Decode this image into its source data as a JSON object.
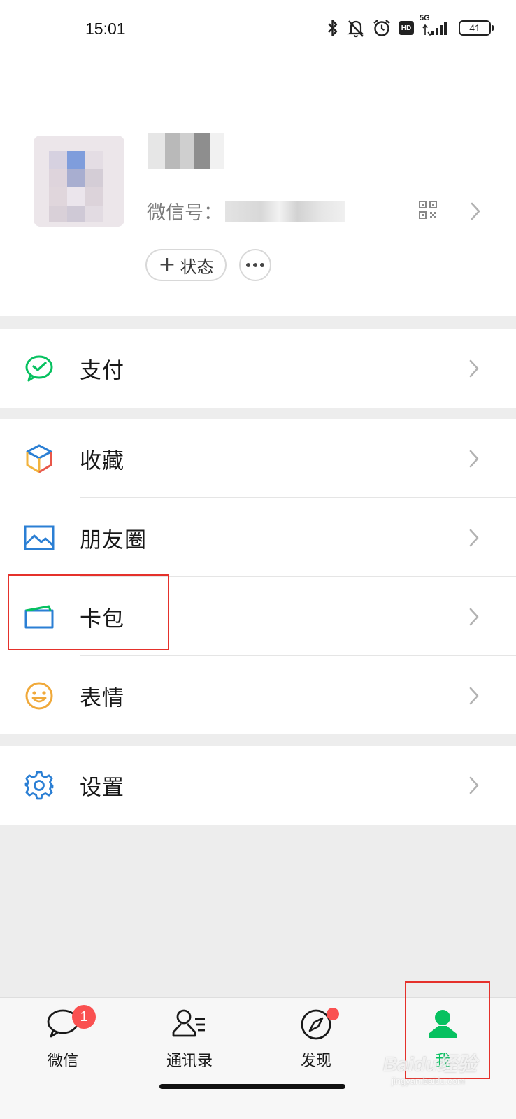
{
  "status_bar": {
    "time": "15:01",
    "network": "5G",
    "hd": "HD",
    "battery": "41"
  },
  "profile": {
    "wxid_label": "微信号：",
    "status_button": "状态",
    "status_plus": "+"
  },
  "menu": {
    "pay": {
      "label": "支付",
      "icon": "wechat-pay-icon",
      "color": "#07c160"
    },
    "favorites": {
      "label": "收藏",
      "icon": "cube-icon"
    },
    "moments": {
      "label": "朋友圈",
      "icon": "image-icon",
      "color": "#2b7fd4"
    },
    "cards": {
      "label": "卡包",
      "icon": "card-icon"
    },
    "stickers": {
      "label": "表情",
      "icon": "smiley-icon",
      "color": "#f0a93a"
    },
    "settings": {
      "label": "设置",
      "icon": "gear-icon",
      "color": "#2b7fd4"
    }
  },
  "tabbar": {
    "chats": {
      "label": "微信",
      "badge": "1"
    },
    "contacts": {
      "label": "通讯录"
    },
    "discover": {
      "label": "发现"
    },
    "me": {
      "label": "我",
      "active": true
    }
  },
  "colors": {
    "accent_green": "#07c160",
    "badge_red": "#fa5151",
    "annotation_red": "#e5312b"
  },
  "watermark": {
    "text": "Baidu经验",
    "sub": "jingyan.baidu.com"
  }
}
